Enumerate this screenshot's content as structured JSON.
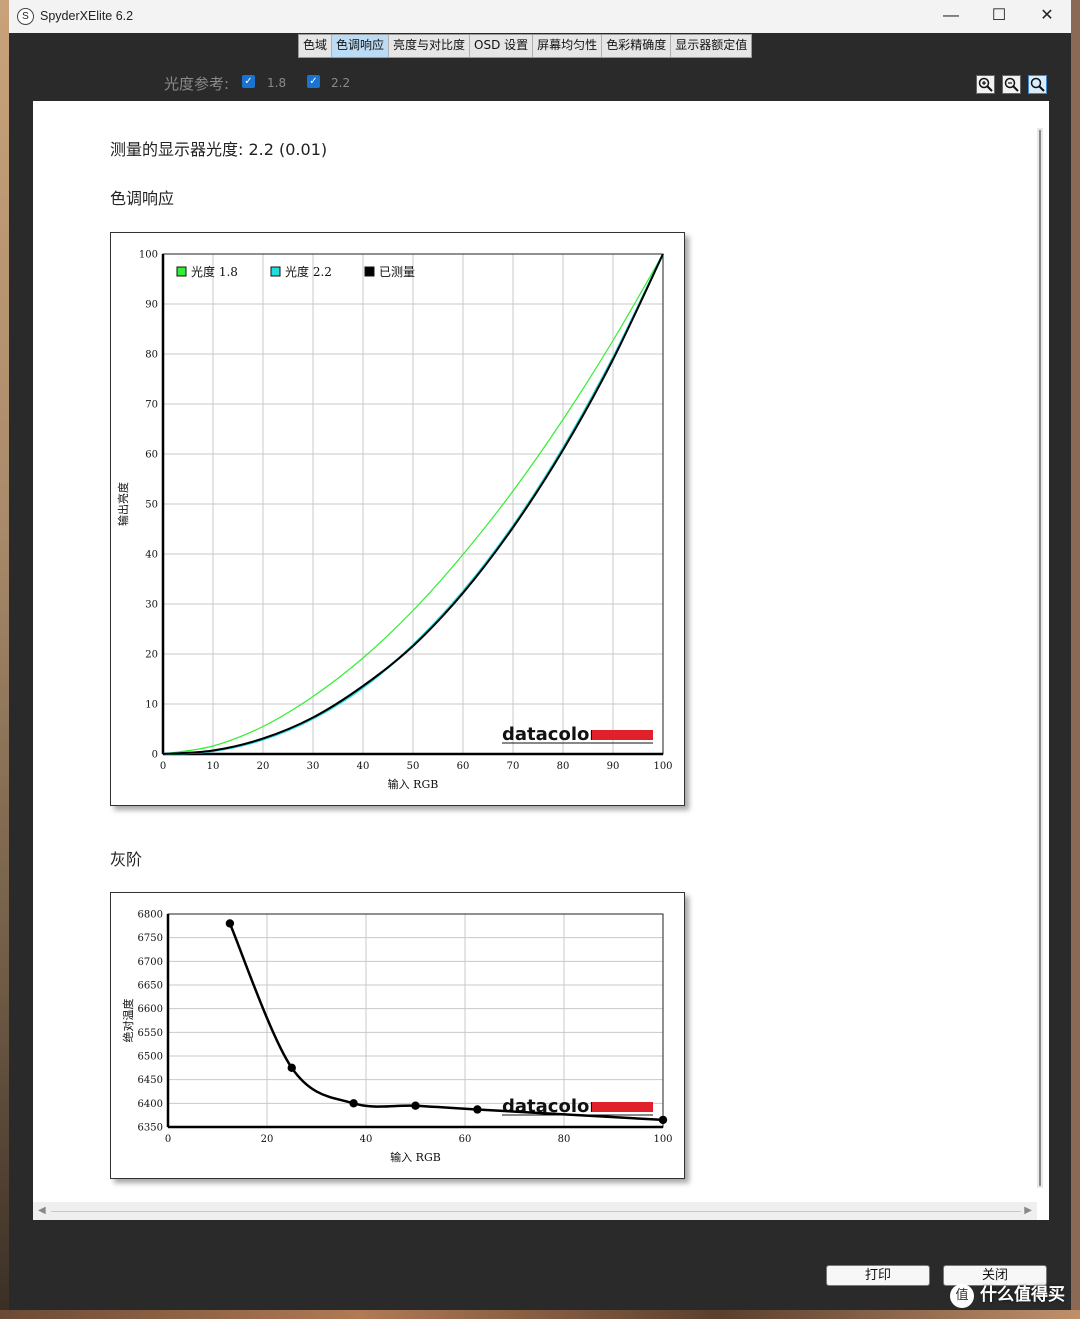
{
  "window": {
    "title": "SpyderXElite 6.2",
    "app_icon_glyph": "S",
    "minimize_glyph": "—",
    "maximize_glyph": "☐",
    "close_glyph": "✕"
  },
  "tabs": [
    {
      "label": "色域",
      "active": false
    },
    {
      "label": "色调响应",
      "active": true
    },
    {
      "label": "亮度与对比度",
      "active": false
    },
    {
      "label": "OSD 设置",
      "active": false
    },
    {
      "label": "屏幕均匀性",
      "active": false
    },
    {
      "label": "色彩精确度",
      "active": false
    },
    {
      "label": "显示器额定值",
      "active": false
    }
  ],
  "gamma_reference": {
    "label": "光度参考:",
    "options": [
      {
        "label": "1.8",
        "checked": true
      },
      {
        "label": "2.2",
        "checked": true
      }
    ]
  },
  "zoom": {
    "zoom_in_icon": "zoom-in-icon",
    "zoom_out_icon": "zoom-out-icon",
    "zoom_fit_icon": "zoom-fit-icon"
  },
  "report": {
    "measured_gamma": "测量的显示器光度:  2.2 (0.01)",
    "tone_title": "色调响应",
    "gray_title": "灰阶"
  },
  "chart_data": [
    {
      "type": "line",
      "xlabel": "输入 RGB",
      "ylabel": "输出亮度",
      "xlim": [
        0,
        100
      ],
      "ylim": [
        0,
        100
      ],
      "xticks": [
        "0",
        "10",
        "20",
        "30",
        "40",
        "50",
        "60",
        "70",
        "80",
        "90",
        "100"
      ],
      "yticks": [
        "0",
        "10",
        "20",
        "30",
        "40",
        "50",
        "60",
        "70",
        "80",
        "90",
        "100"
      ],
      "grid": true,
      "legend_position": "top-left",
      "brand": "datacolor",
      "series": [
        {
          "name": "光度 1.8",
          "color": "#33ee33",
          "x": [
            0,
            10,
            20,
            30,
            40,
            50,
            60,
            70,
            80,
            90,
            100
          ],
          "y": [
            0,
            1.6,
            5.5,
            11.5,
            19.2,
            28.7,
            39.9,
            52.6,
            66.9,
            82.7,
            100
          ]
        },
        {
          "name": "光度 2.2",
          "color": "#22dddd",
          "x": [
            0,
            10,
            20,
            30,
            40,
            50,
            60,
            70,
            80,
            90,
            100
          ],
          "y": [
            0,
            0.6,
            2.9,
            7.1,
            13.3,
            21.8,
            32.5,
            45.6,
            61.2,
            79.3,
            100
          ]
        },
        {
          "name": "已测量",
          "color": "#000000",
          "x": [
            0,
            10,
            20,
            30,
            40,
            50,
            60,
            70,
            80,
            90,
            100
          ],
          "y": [
            0,
            0.7,
            3.1,
            7.3,
            13.6,
            21.6,
            32.2,
            45.3,
            60.8,
            78.9,
            100
          ]
        }
      ]
    },
    {
      "type": "line",
      "xlabel": "输入 RGB",
      "ylabel": "绝对温度",
      "xlim": [
        0,
        100
      ],
      "ylim": [
        6350,
        6800
      ],
      "xticks": [
        "0",
        "20",
        "40",
        "60",
        "80",
        "100"
      ],
      "yticks": [
        "6350",
        "6400",
        "6450",
        "6500",
        "6550",
        "6600",
        "6650",
        "6700",
        "6750",
        "6800"
      ],
      "grid": true,
      "brand": "datacolor",
      "series": [
        {
          "name": "",
          "color": "#000000",
          "x": [
            12.5,
            25,
            37.5,
            50,
            62.5,
            100
          ],
          "y": [
            6780,
            6475,
            6400,
            6395,
            6387,
            6365
          ]
        }
      ]
    }
  ],
  "buttons": {
    "print": "打印",
    "close": "关闭"
  },
  "watermark": {
    "icon_glyph": "值",
    "text": "什么值得买"
  },
  "scroll": {
    "left_arrow": "◀",
    "right_arrow": "▶"
  }
}
